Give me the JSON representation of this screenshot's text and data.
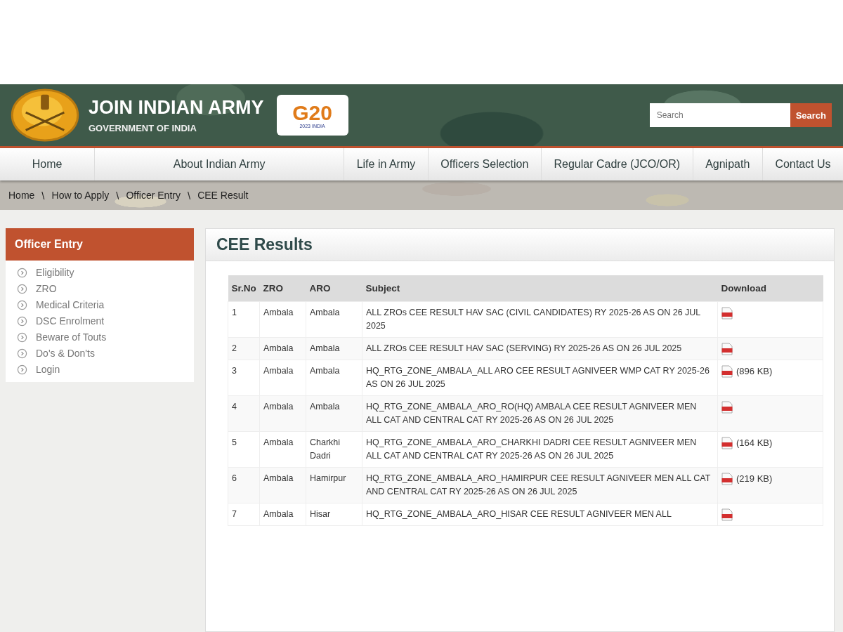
{
  "header": {
    "title": "JOIN INDIAN ARMY",
    "subtitle": "GOVERNMENT OF INDIA",
    "badge": {
      "text": "G20",
      "tagline": "2023 INDIA"
    },
    "search": {
      "placeholder": "Search",
      "button": "Search"
    }
  },
  "nav": [
    "Home",
    "About Indian Army",
    "Life in Army",
    "Officers Selection",
    "Regular Cadre (JCO/OR)",
    "Agnipath",
    "Contact Us"
  ],
  "breadcrumb": [
    "Home",
    "How to Apply",
    "Officer Entry",
    "CEE Result"
  ],
  "breadcrumb_separator": "\\",
  "sidebar": {
    "title": "Officer Entry",
    "items": [
      "Eligibility",
      "ZRO",
      "Medical Criteria",
      "DSC Enrolment",
      "Beware of Touts",
      "Do's & Don'ts",
      "Login"
    ]
  },
  "content": {
    "title": "CEE Results",
    "table": {
      "columns": [
        "Sr.No",
        "ZRO",
        "ARO",
        "Subject",
        "Download"
      ],
      "rows": [
        {
          "sr": "1",
          "zro": "Ambala",
          "aro": "Ambala",
          "subject": "ALL ZROs CEE RESULT HAV SAC (CIVIL CANDIDATES) RY 2025-26 AS ON 26 JUL 2025"
        },
        {
          "sr": "2",
          "zro": "Ambala",
          "aro": "Ambala",
          "subject": "ALL ZROs CEE RESULT HAV SAC (SERVING) RY 2025-26 AS ON 26 JUL 2025"
        },
        {
          "sr": "3",
          "zro": "Ambala",
          "aro": "Ambala",
          "subject": "HQ_RTG_ZONE_AMBALA_ALL ARO CEE RESULT AGNIVEER WMP CAT RY 2025-26 AS ON 26 JUL 2025",
          "size": "(896 KB)"
        },
        {
          "sr": "4",
          "zro": "Ambala",
          "aro": "Ambala",
          "subject": "HQ_RTG_ZONE_AMBALA_ARO_RO(HQ) AMBALA CEE RESULT AGNIVEER MEN ALL CAT AND CENTRAL CAT RY 2025-26 AS ON 26 JUL 2025"
        },
        {
          "sr": "5",
          "zro": "Ambala",
          "aro": "Charkhi Dadri",
          "subject": "HQ_RTG_ZONE_AMBALA_ARO_CHARKHI DADRI CEE RESULT AGNIVEER MEN ALL CAT AND CENTRAL CAT RY 2025-26 AS ON 26 JUL 2025",
          "size": "(164 KB)"
        },
        {
          "sr": "6",
          "zro": "Ambala",
          "aro": "Hamirpur",
          "subject": "HQ_RTG_ZONE_AMBALA_ARO_HAMIRPUR CEE RESULT AGNIVEER MEN ALL CAT AND CENTRAL CAT RY 2025-26 AS ON 26 JUL 2025",
          "size": "(219 KB)"
        },
        {
          "sr": "7",
          "zro": "Ambala",
          "aro": "Hisar",
          "subject": "HQ_RTG_ZONE_AMBALA_ARO_HISAR CEE RESULT AGNIVEER MEN ALL"
        }
      ]
    }
  }
}
